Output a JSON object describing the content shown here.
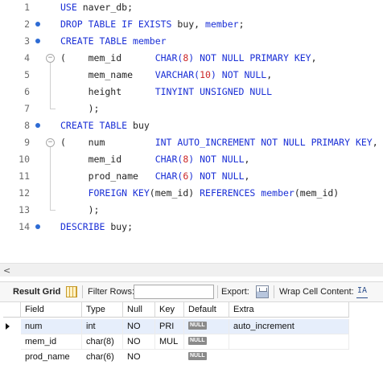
{
  "editor": {
    "lines": [
      {
        "num": "1",
        "dot": false,
        "fold": "",
        "tokens": [
          {
            "t": "USE",
            "c": "kw"
          },
          {
            "t": " naver_db;",
            "c": "obj"
          }
        ]
      },
      {
        "num": "2",
        "dot": true,
        "fold": "",
        "tokens": [
          {
            "t": "DROP TABLE IF EXISTS",
            "c": "kw"
          },
          {
            "t": " buy, ",
            "c": "obj"
          },
          {
            "t": "member",
            "c": "kw"
          },
          {
            "t": ";",
            "c": "obj"
          }
        ]
      },
      {
        "num": "3",
        "dot": true,
        "fold": "",
        "tokens": [
          {
            "t": "CREATE TABLE",
            "c": "kw"
          },
          {
            "t": " ",
            "c": "obj"
          },
          {
            "t": "member",
            "c": "kw"
          }
        ]
      },
      {
        "num": "4",
        "dot": false,
        "fold": "open",
        "tokens": [
          {
            "t": "(    mem_id      ",
            "c": "obj"
          },
          {
            "t": "CHAR(",
            "c": "ty"
          },
          {
            "t": "8",
            "c": "num"
          },
          {
            "t": ") NOT NULL PRIMARY KEY",
            "c": "ty"
          },
          {
            "t": ",",
            "c": "obj"
          }
        ]
      },
      {
        "num": "5",
        "dot": false,
        "fold": "",
        "tokens": [
          {
            "t": "     mem_name    ",
            "c": "obj"
          },
          {
            "t": "VARCHAR(",
            "c": "ty"
          },
          {
            "t": "10",
            "c": "num"
          },
          {
            "t": ") NOT NULL",
            "c": "ty"
          },
          {
            "t": ",",
            "c": "obj"
          }
        ]
      },
      {
        "num": "6",
        "dot": false,
        "fold": "",
        "tokens": [
          {
            "t": "     height      ",
            "c": "obj"
          },
          {
            "t": "TINYINT UNSIGNED NULL",
            "c": "ty"
          }
        ]
      },
      {
        "num": "7",
        "dot": false,
        "fold": "end",
        "tokens": [
          {
            "t": "     );",
            "c": "obj"
          }
        ]
      },
      {
        "num": "8",
        "dot": true,
        "fold": "",
        "tokens": [
          {
            "t": "CREATE TABLE",
            "c": "kw"
          },
          {
            "t": " buy",
            "c": "obj"
          }
        ]
      },
      {
        "num": "9",
        "dot": false,
        "fold": "open",
        "tokens": [
          {
            "t": "(    num         ",
            "c": "obj"
          },
          {
            "t": "INT AUTO_INCREMENT NOT NULL PRIMARY KEY",
            "c": "ty"
          },
          {
            "t": ",",
            "c": "obj"
          }
        ]
      },
      {
        "num": "10",
        "dot": false,
        "fold": "",
        "tokens": [
          {
            "t": "     mem_id      ",
            "c": "obj"
          },
          {
            "t": "CHAR(",
            "c": "ty"
          },
          {
            "t": "8",
            "c": "num"
          },
          {
            "t": ") NOT NULL",
            "c": "ty"
          },
          {
            "t": ",",
            "c": "obj"
          }
        ]
      },
      {
        "num": "11",
        "dot": false,
        "fold": "",
        "tokens": [
          {
            "t": "     prod_name   ",
            "c": "obj"
          },
          {
            "t": "CHAR(",
            "c": "ty"
          },
          {
            "t": "6",
            "c": "num"
          },
          {
            "t": ") NOT NULL",
            "c": "ty"
          },
          {
            "t": ",",
            "c": "obj"
          }
        ]
      },
      {
        "num": "12",
        "dot": false,
        "fold": "",
        "tokens": [
          {
            "t": "     ",
            "c": "obj"
          },
          {
            "t": "FOREIGN KEY",
            "c": "kw"
          },
          {
            "t": "(mem_id) ",
            "c": "obj"
          },
          {
            "t": "REFERENCES",
            "c": "kw"
          },
          {
            "t": " ",
            "c": "obj"
          },
          {
            "t": "member",
            "c": "kw"
          },
          {
            "t": "(mem_id)",
            "c": "obj"
          }
        ]
      },
      {
        "num": "13",
        "dot": false,
        "fold": "end",
        "tokens": [
          {
            "t": "     );",
            "c": "obj"
          }
        ]
      },
      {
        "num": "14",
        "dot": true,
        "fold": "",
        "tokens": [
          {
            "t": "DESCRIBE",
            "c": "kw"
          },
          {
            "t": " buy;",
            "c": "obj"
          }
        ]
      }
    ]
  },
  "scrollbar": {
    "left_arrow": "<"
  },
  "toolbar": {
    "result_grid_label": "Result Grid",
    "filter_rows_label": "Filter Rows:",
    "filter_rows_value": "",
    "export_label": "Export:",
    "wrap_label": "Wrap Cell Content:",
    "wrap_icon_text": "IA"
  },
  "result_grid": {
    "columns": [
      "Field",
      "Type",
      "Null",
      "Key",
      "Default",
      "Extra"
    ],
    "null_badge": "NULL",
    "rows": [
      {
        "Field": "num",
        "Type": "int",
        "Null": "NO",
        "Key": "PRI",
        "Default": "NULL",
        "Extra": "auto_increment",
        "selected": true
      },
      {
        "Field": "mem_id",
        "Type": "char(8)",
        "Null": "NO",
        "Key": "MUL",
        "Default": "NULL",
        "Extra": "",
        "selected": false
      },
      {
        "Field": "prod_name",
        "Type": "char(6)",
        "Null": "NO",
        "Key": "",
        "Default": "NULL",
        "Extra": "",
        "selected": false
      }
    ]
  },
  "colors": {
    "keyword": "#1a2fd6",
    "number": "#cc2727",
    "statement_dot": "#2d6bd4",
    "selected_row": "#e6eefb"
  }
}
